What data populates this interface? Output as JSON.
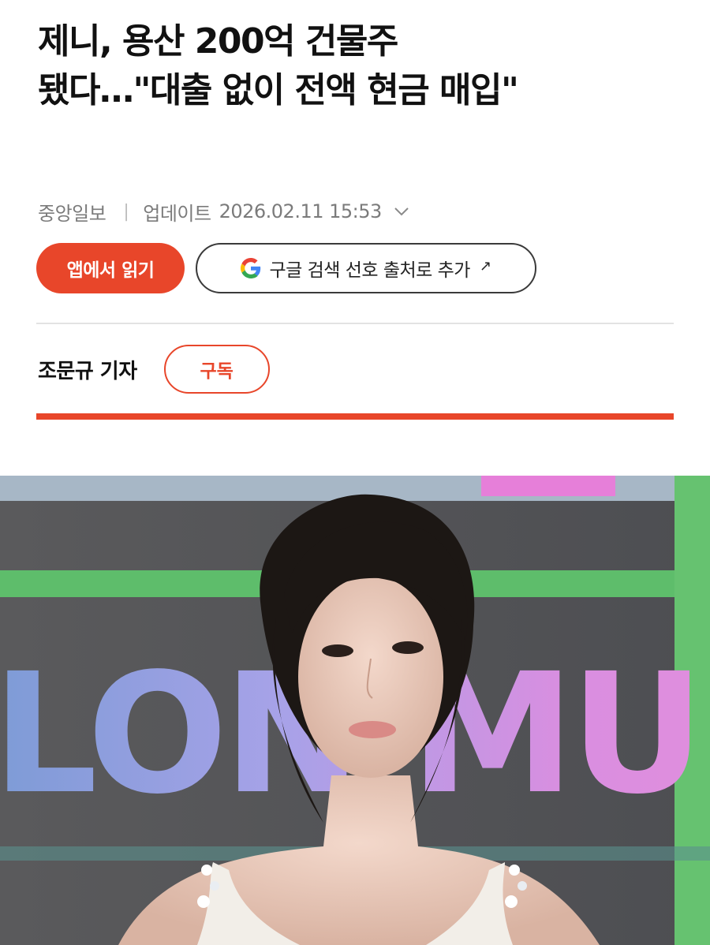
{
  "article": {
    "headline_line1": "제니, 용산 200억 건물주",
    "headline_line2": "됐다…\"대출 없이 전액 현금 매입\"",
    "publisher": "중앙일보",
    "separator": "|",
    "update_label": "업데이트",
    "updated_at": "2026.02.11 15:53",
    "reporter": "조문규 기자"
  },
  "buttons": {
    "read_in_app": "앱에서 읽기",
    "google_preferred_source": "구글 검색 선호 출처로 추가",
    "google_external_icon": "↗",
    "subscribe": "구독"
  },
  "photo": {
    "backdrop_text": "LON MUS"
  },
  "icons": {
    "google_logo": "google-icon",
    "expand": "chevron-down-icon",
    "external": "arrow-up-right-icon"
  },
  "colors": {
    "accent": "#e8462a",
    "text_primary": "#111111",
    "text_meta": "#7b7b7b"
  }
}
